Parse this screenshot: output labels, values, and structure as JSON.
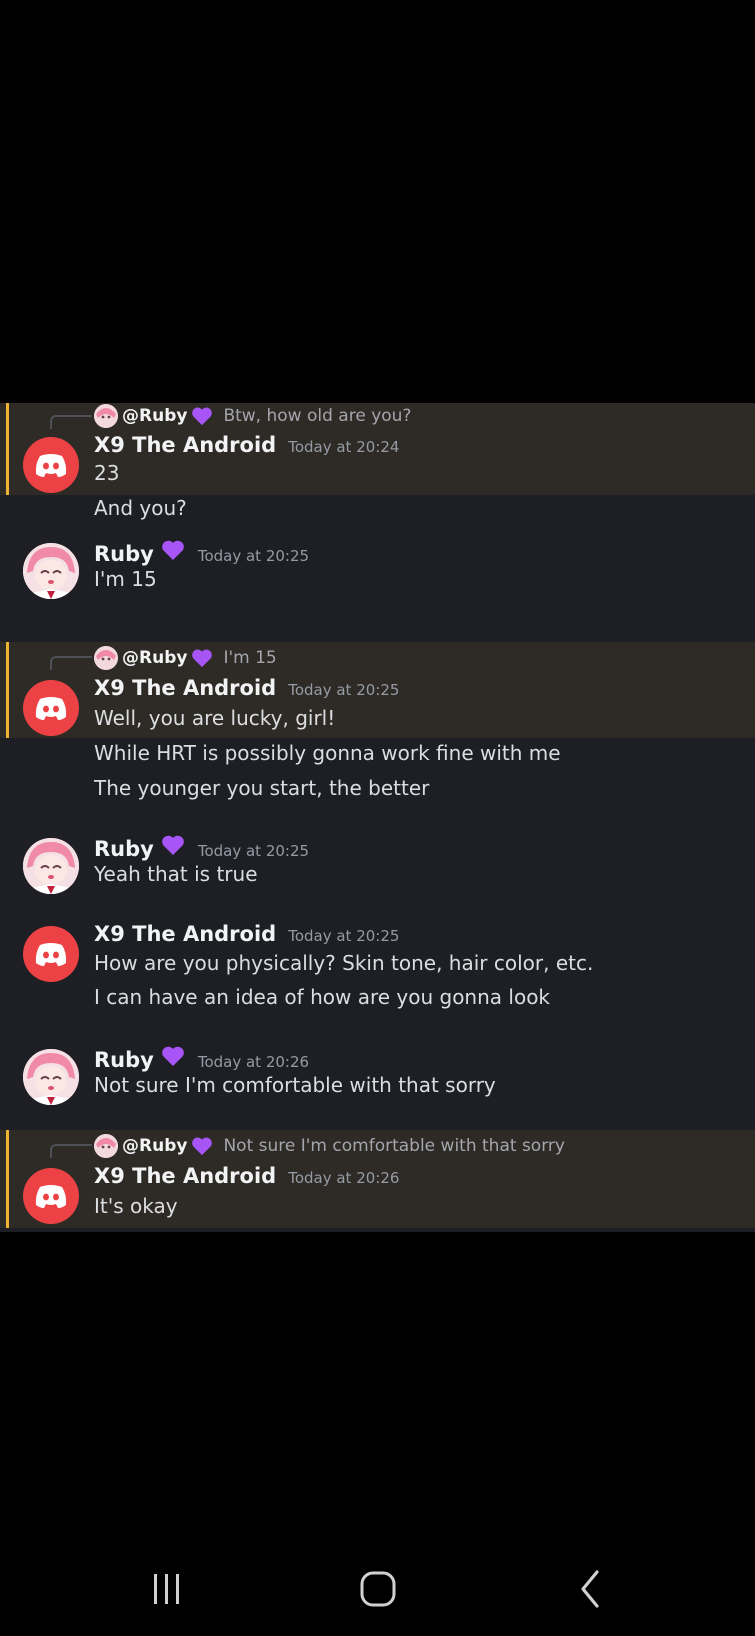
{
  "messages": [
    {
      "reply_to": {
        "user": "@Ruby",
        "text": "Btw, how old are you?"
      },
      "author": "X9 The Android",
      "timestamp": "Today at 20:24",
      "lines": [
        "23",
        "And you?"
      ]
    },
    {
      "author": "Ruby",
      "timestamp": "Today at 20:25",
      "lines": [
        "I'm 15"
      ]
    },
    {
      "reply_to": {
        "user": "@Ruby",
        "text": "I'm 15"
      },
      "author": "X9 The Android",
      "timestamp": "Today at 20:25",
      "lines": [
        "Well, you are lucky, girl!",
        "While HRT is possibly gonna work fine with me",
        "The younger you start, the better"
      ]
    },
    {
      "author": "Ruby",
      "timestamp": "Today at 20:25",
      "lines": [
        "Yeah that is true"
      ]
    },
    {
      "author": "X9 The Android",
      "timestamp": "Today at 20:25",
      "lines": [
        "How are you physically? Skin tone, hair color, etc.",
        "I can have an idea of how are you gonna look"
      ]
    },
    {
      "author": "Ruby",
      "timestamp": "Today at 20:26",
      "lines": [
        "Not sure I'm comfortable with that sorry"
      ]
    },
    {
      "reply_to": {
        "user": "@Ruby",
        "text": "Not sure I'm comfortable with that sorry"
      },
      "author": "X9 The Android",
      "timestamp": "Today at 20:26",
      "lines": [
        "It's okay"
      ]
    }
  ],
  "colors": {
    "mention_highlight": "#2e2b26",
    "mention_bar": "#f0b232",
    "discord_avatar": "#ed4245",
    "heart": "#a855f7"
  },
  "navbar": {
    "icons": [
      "recent-apps-icon",
      "home-icon",
      "back-icon"
    ]
  }
}
